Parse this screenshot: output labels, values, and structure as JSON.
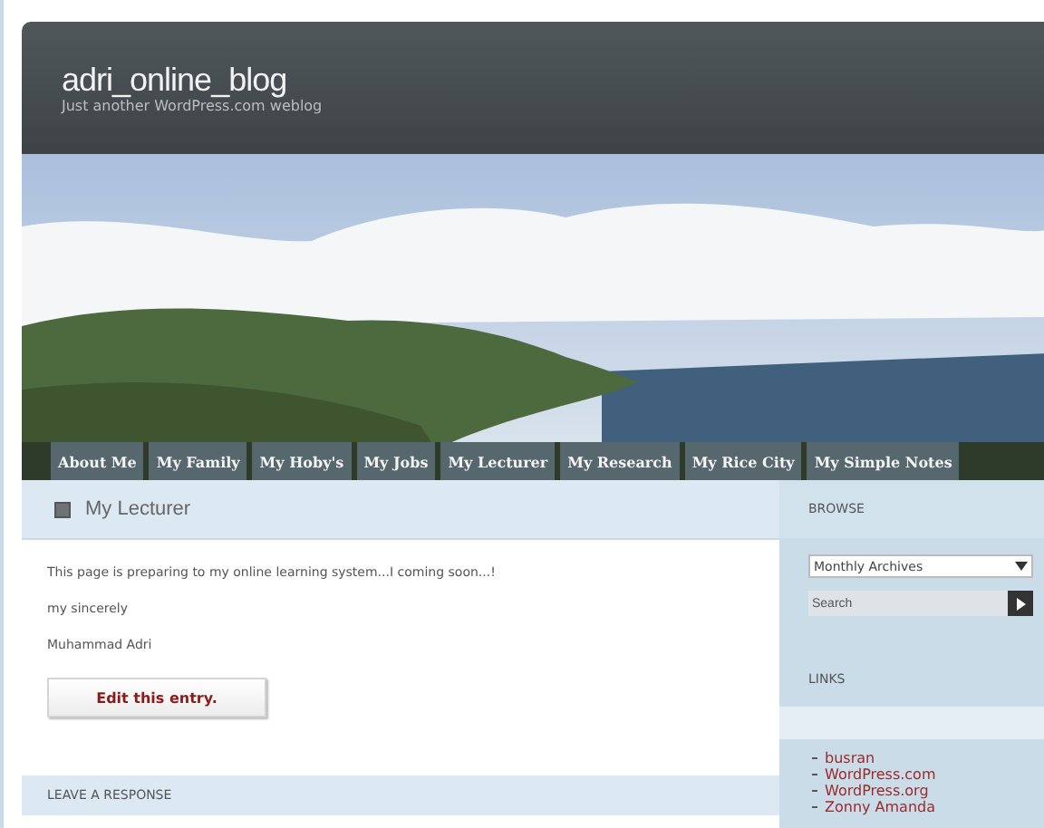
{
  "header": {
    "title": "adri_online_blog",
    "tagline": "Just another WordPress.com weblog"
  },
  "nav": [
    "About Me",
    "My Family",
    "My Hoby's",
    "My Jobs",
    "My Lecturer",
    "My Research",
    "My Rice City",
    "My Simple Notes"
  ],
  "post": {
    "title": "My Lecturer",
    "paragraphs": [
      "This page is preparing to my online learning system...I coming soon...!",
      "my sincerely",
      "Muhammad Adri"
    ],
    "edit_button": "Edit this entry.",
    "leave_response": "LEAVE A RESPONSE"
  },
  "sidebar": {
    "browse_title": "BROWSE",
    "archives_select": "Monthly Archives",
    "search_placeholder": "Search",
    "links_title": "LINKS",
    "links": [
      "busran",
      "WordPress.com",
      "WordPress.org",
      "Zonny Amanda"
    ]
  }
}
